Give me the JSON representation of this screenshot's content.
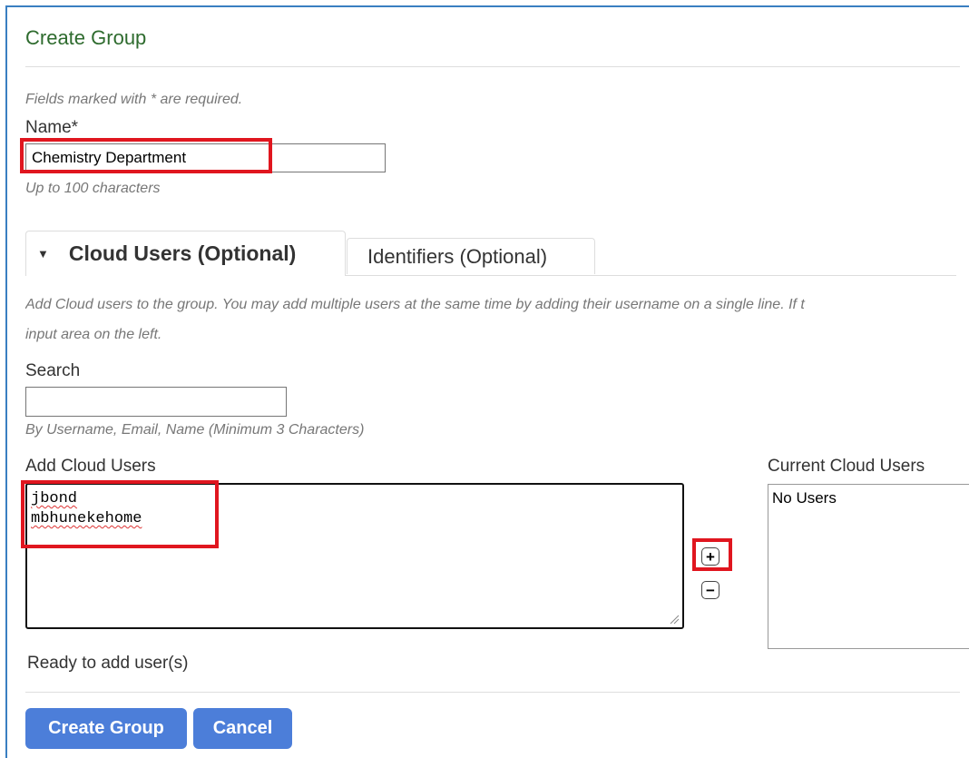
{
  "header": {
    "title": "Create Group"
  },
  "form": {
    "required_note": "Fields marked with * are required.",
    "name_label": "Name*",
    "name_value": "Chemistry Department",
    "name_help": "Up to 100 characters"
  },
  "tabs": [
    {
      "label": "Cloud Users (Optional)",
      "active": true,
      "icon": "caret-down-icon"
    },
    {
      "label": "Identifiers (Optional)",
      "active": false
    }
  ],
  "cloud_users": {
    "description_line1": "Add Cloud users to the group. You may add multiple users at the same time by adding their username on a single line. If t",
    "description_line2": "input area on the left.",
    "search_label": "Search",
    "search_value": "",
    "search_help": "By Username, Email, Name (Minimum 3 Characters)",
    "add_label": "Add Cloud Users",
    "add_entries": [
      "jbond",
      "mbhunekehome"
    ],
    "add_button_icon": "plus-icon",
    "add_button_symbol": "+",
    "remove_button_icon": "minus-icon",
    "remove_button_symbol": "−",
    "current_label": "Current Cloud Users",
    "current_items": [
      "No Users"
    ],
    "status": "Ready to add user(s)"
  },
  "actions": {
    "create_label": "Create Group",
    "cancel_label": "Cancel"
  },
  "colors": {
    "title": "#2e6b2e",
    "primary_button": "#4c7ed9",
    "highlight": "#e0161f",
    "frame": "#3a7fc1"
  }
}
